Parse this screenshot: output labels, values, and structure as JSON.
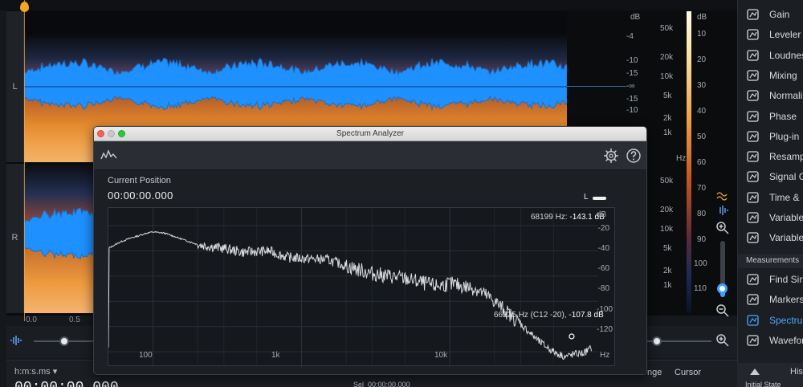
{
  "editor": {
    "channels": [
      "L",
      "R"
    ],
    "db_scale_top": [
      "dB",
      "-4",
      "-10",
      "-15",
      "-∞",
      "-15",
      "-10"
    ],
    "hz_scale_top": [
      "50k",
      "20k",
      "10k",
      "5k",
      "2k",
      "1k"
    ],
    "hz_scale_bottom": [
      "50k",
      "20k",
      "10k",
      "5k",
      "2k",
      "1k"
    ],
    "hz_unit": "Hz",
    "colorbar_labels": [
      "dB",
      "10",
      "20",
      "30",
      "40",
      "50",
      "60",
      "70",
      "80",
      "90",
      "100",
      "110"
    ],
    "timeline": [
      "0.0",
      "0.5"
    ]
  },
  "status": {
    "time_format": "h:m:s.ms",
    "big_time": "00:00:00.000",
    "sel_label": "Sel",
    "sel_value": "00:00:00.000",
    "range_label": "nge",
    "cursor_label": "Cursor"
  },
  "analyzer": {
    "window_title": "Spectrum Analyzer",
    "position_label": "Current Position",
    "position_time": "00:00:00.000",
    "channel": "L",
    "y_unit": "dB",
    "y_ticks": [
      "-20",
      "-40",
      "-60",
      "-80",
      "-100",
      "-120"
    ],
    "x_ticks": [
      "100",
      "1k",
      "10k",
      "Hz"
    ],
    "readout_top_freq": "68199 Hz:",
    "readout_top_db": "-143.1 dB",
    "readout_cursor_freq": "66225 Hz (C12 -20),",
    "readout_cursor_db": "-107.8 dB"
  },
  "modules": [
    {
      "label": "Gain",
      "icon": "gain-icon"
    },
    {
      "label": "Leveler",
      "icon": "leveler-icon"
    },
    {
      "label": "Loudnes",
      "icon": "loudness-icon"
    },
    {
      "label": "Mixing",
      "icon": "mixing-icon"
    },
    {
      "label": "Normali",
      "icon": "normalize-icon"
    },
    {
      "label": "Phase",
      "icon": "phase-icon"
    },
    {
      "label": "Plug-in",
      "icon": "plugin-icon"
    },
    {
      "label": "Resamp",
      "icon": "resample-icon"
    },
    {
      "label": "Signal G",
      "icon": "signal-generator-icon"
    },
    {
      "label": "Time & I",
      "icon": "time-pitch-icon"
    },
    {
      "label": "Variable",
      "icon": "variable-gain-icon"
    },
    {
      "label": "Variable",
      "icon": "variable-pitch-icon"
    }
  ],
  "measurements_label": "Measurements",
  "measure_modules": [
    {
      "label": "Find Sin",
      "icon": "find-similar-icon"
    },
    {
      "label": "Markers",
      "icon": "markers-icon"
    },
    {
      "label": "Spectrum",
      "icon": "spectrum-icon",
      "active": true
    },
    {
      "label": "Wavefor",
      "icon": "waveform-icon"
    }
  ],
  "history": {
    "label": "His",
    "initial_state": "Initial State"
  },
  "colors": {
    "accent": "#3aa0ff",
    "waveform": "#1e90ff",
    "spectro_hot": "#e8862a"
  },
  "spectrum_curve": [
    [
      50,
      -38
    ],
    [
      60,
      -33
    ],
    [
      70,
      -30
    ],
    [
      80,
      -28
    ],
    [
      90,
      -26
    ],
    [
      100,
      -25
    ],
    [
      120,
      -26
    ],
    [
      150,
      -30
    ],
    [
      200,
      -35
    ],
    [
      300,
      -38
    ],
    [
      400,
      -41
    ],
    [
      600,
      -40
    ],
    [
      800,
      -45
    ],
    [
      1000,
      -46
    ],
    [
      1500,
      -47
    ],
    [
      2000,
      -52
    ],
    [
      3000,
      -58
    ],
    [
      5000,
      -62
    ],
    [
      8000,
      -68
    ],
    [
      10000,
      -66
    ],
    [
      15000,
      -70
    ],
    [
      20000,
      -80
    ],
    [
      30000,
      -98
    ],
    [
      40000,
      -112
    ],
    [
      50000,
      -120
    ],
    [
      60000,
      -124
    ],
    [
      68199,
      -122
    ],
    [
      80000,
      -121
    ],
    [
      90000,
      -117
    ]
  ]
}
